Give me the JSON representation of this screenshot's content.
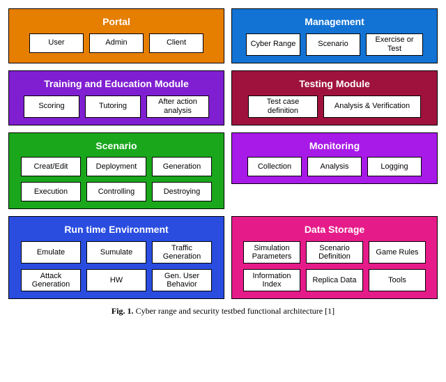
{
  "modules": {
    "portal": {
      "title": "Portal",
      "color": "#e67e00",
      "items": [
        "User",
        "Admin",
        "Client"
      ]
    },
    "management": {
      "title": "Management",
      "color": "#1273d4",
      "items": [
        "Cyber Range",
        "Scenario",
        "Exercise or Test"
      ]
    },
    "training": {
      "title": "Training and Education Module",
      "color": "#7f1fd1",
      "items": [
        "Scoring",
        "Tutoring",
        "After action analysis"
      ]
    },
    "testing": {
      "title": "Testing Module",
      "color": "#a0123e",
      "items": [
        "Test case definition",
        "Analysis & Verification"
      ]
    },
    "scenario": {
      "title": "Scenario",
      "color": "#1aa71c",
      "items": [
        "Creat/Edit",
        "Deployment",
        "Generation",
        "Execution",
        "Controlling",
        "Destroying"
      ]
    },
    "monitoring": {
      "title": "Monitoring",
      "color": "#a81ae8",
      "items": [
        "Collection",
        "Analysis",
        "Logging"
      ]
    },
    "runtime": {
      "title": "Run time Environment",
      "color": "#2a4de0",
      "items": [
        "Emulate",
        "Sumulate",
        "Traffic Generation",
        "Attack Generation",
        "HW",
        "Gen. User Behavior"
      ]
    },
    "storage": {
      "title": "Data Storage",
      "color": "#e61b8a",
      "items": [
        "Simulation Parameters",
        "Scenario Definition",
        "Game Rules",
        "Information Index",
        "Replica Data",
        "Tools"
      ]
    }
  },
  "caption_prefix": "Fig. 1.",
  "caption_text": "Cyber range and security testbed functional architecture [1]"
}
